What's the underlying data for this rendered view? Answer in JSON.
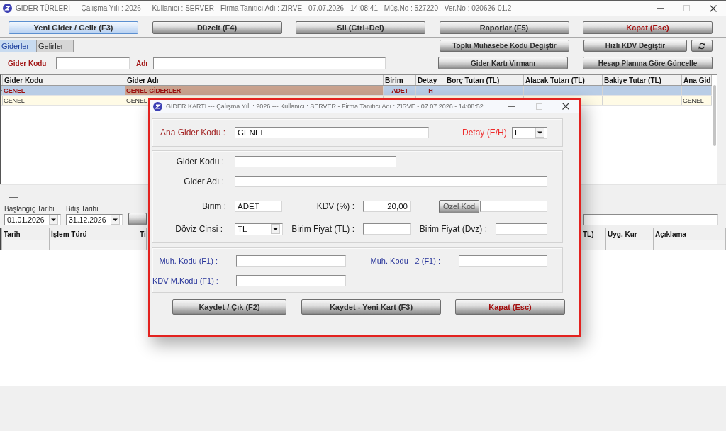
{
  "window": {
    "title": "GİDER TÜRLERİ --- Çalışma Yılı : 2026 --- Kullanıcı : SERVER - Firma Tanıtıcı Adı : ZİRVE - 07.07.2026 - 14:08:41 - Müş.No : 527220 - Ver.No : 020626-01.2"
  },
  "toolbar": [
    {
      "label": "Yeni Gider / Gelir (F3)",
      "selected": true,
      "kind": "normal"
    },
    {
      "label": "Düzelt (F4)",
      "selected": false,
      "kind": "normal"
    },
    {
      "label": "Sil (Ctrl+Del)",
      "selected": false,
      "kind": "normal"
    },
    {
      "label": "Raporlar (F5)",
      "selected": false,
      "kind": "normal"
    },
    {
      "label": "Kapat (Esc)",
      "selected": false,
      "kind": "close"
    }
  ],
  "tab_row": {
    "tabs": [
      {
        "label": "Giderler",
        "selected": true
      },
      {
        "label": "Gelirler",
        "selected": false
      }
    ],
    "buttons": [
      "Toplu Muhasebe Kodu Değiştir",
      "Hızlı KDV Değiştir"
    ]
  },
  "filter_row": {
    "gider_kodu": {
      "label": {
        "before": "Gider ",
        "key": "K",
        "after": "odu"
      }
    },
    "adi": {
      "label": {
        "key": "A",
        "after": "dı"
      }
    },
    "buttons": [
      "Gider Kartı Virmanı",
      "Hesap Planına Göre Güncelle"
    ]
  },
  "table": {
    "columns": [
      "Gider Kodu",
      "Gider Adı",
      "Birim",
      "Detay",
      "Borç Tutarı (TL)",
      "Alacak Tutarı (TL)",
      "Bakiye Tutar (TL)",
      "Ana Gid"
    ],
    "rows": [
      {
        "selected": true,
        "gider_kodu": {
          "text": "GENEL",
          "focused": false
        },
        "gider_adi": {
          "text": "GENEL GİDERLER",
          "focused": true
        },
        "birim": {
          "text": "ADET",
          "focused": false
        },
        "detay": {
          "text": "H",
          "focused": false
        }
      },
      {
        "selected": false,
        "gider_kodu": {
          "text": "GENEL",
          "focused": false
        },
        "gider_adi": {
          "text": "GENEL",
          "focused": false
        },
        "column_8": {
          "text": "GENEL",
          "focused": false
        }
      }
    ]
  },
  "date_range": {
    "start": {
      "label": "Başlangıç Tarihi",
      "value": "01.01.2026"
    },
    "end": {
      "label": "Bitiş Tarihi",
      "value": "31.12.2026"
    }
  },
  "movements": {
    "columns": [
      "Tarih",
      "İşlem Türü",
      "Ti",
      "TL)",
      "Uyg. Kur",
      "Açıklama"
    ]
  },
  "dialog": {
    "title": "GİDER KARTI --- Çalışma Yılı : 2026 --- Kullanıcı : SERVER - Firma Tanıtıcı Adı : ZİRVE - 07.07.2026 - 14:08:52...",
    "ana_gider_kodu": {
      "label": "Ana Gider Kodu :",
      "value": "GENEL"
    },
    "detay": {
      "label": "Detay (E/H)",
      "value": "E"
    },
    "gider_kodu": {
      "label": "Gider Kodu :"
    },
    "gider_adi": {
      "label": "Gider Adı :"
    },
    "birim": {
      "label": "Birim :",
      "value": "ADET"
    },
    "kdv": {
      "label": "KDV (%) :",
      "value": "20,00"
    },
    "ozel_kod": {
      "button": "Özel Kod"
    },
    "doviz_cinsi": {
      "label": "Döviz Cinsi :",
      "value": "TL"
    },
    "birim_fiyat_tl": {
      "label": "Birim Fiyat (TL) :"
    },
    "birim_fiyat_dvz": {
      "label": "Birim Fiyat (Dvz) :"
    },
    "muh_kodu": {
      "label": "Muh. Kodu (F1) :"
    },
    "muh_kodu_2": {
      "label": "Muh. Kodu - 2 (F1) :"
    },
    "kdv_m_kodu": {
      "label": "KDV M.Kodu (F1) :"
    },
    "buttons": [
      {
        "label": "Kaydet / Çık (F2)",
        "kind": "normal"
      },
      {
        "label": "Kaydet - Yeni Kart (F3)",
        "kind": "normal"
      },
      {
        "label": "Kapat (Esc)",
        "kind": "close"
      }
    ]
  }
}
